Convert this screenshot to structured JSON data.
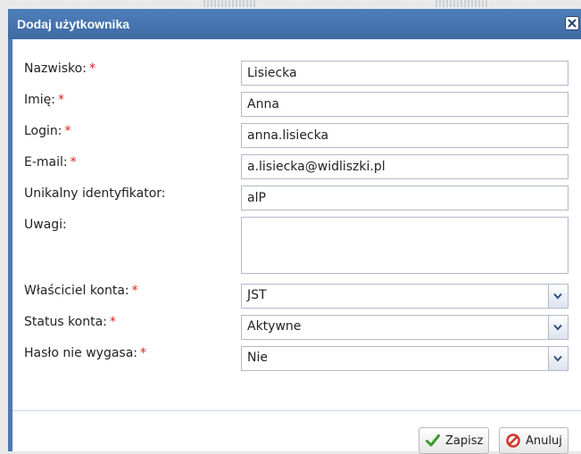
{
  "dialog": {
    "title": "Dodaj użytkownika",
    "close_icon": "close-icon"
  },
  "form": {
    "required_marker": "*",
    "fields": {
      "surname": {
        "label": "Nazwisko:",
        "value": "Lisiecka",
        "required": true
      },
      "first_name": {
        "label": "Imię:",
        "value": "Anna",
        "required": true
      },
      "login": {
        "label": "Login:",
        "value": "anna.lisiecka",
        "required": true
      },
      "email": {
        "label": "E-mail:",
        "value": "a.lisiecka@widliszki.pl",
        "required": true
      },
      "unique_id": {
        "label": "Unikalny identyfikator:",
        "value": "alP",
        "required": false
      },
      "notes": {
        "label": "Uwagi:",
        "value": "",
        "required": false
      },
      "owner": {
        "label": "Właściciel konta:",
        "value": "JST",
        "required": true
      },
      "status": {
        "label": "Status konta:",
        "value": "Aktywne",
        "required": true
      },
      "password_never_expires": {
        "label": "Hasło nie wygasa:",
        "value": "Nie",
        "required": true
      }
    }
  },
  "buttons": {
    "save": {
      "label": "Zapisz",
      "icon": "checkmark-icon",
      "icon_color": "#3a9a2a"
    },
    "cancel": {
      "label": "Anuluj",
      "icon": "cancel-icon",
      "icon_color": "#d0382a"
    }
  },
  "colors": {
    "titlebar": "#4e79b0",
    "required": "#e02020"
  }
}
